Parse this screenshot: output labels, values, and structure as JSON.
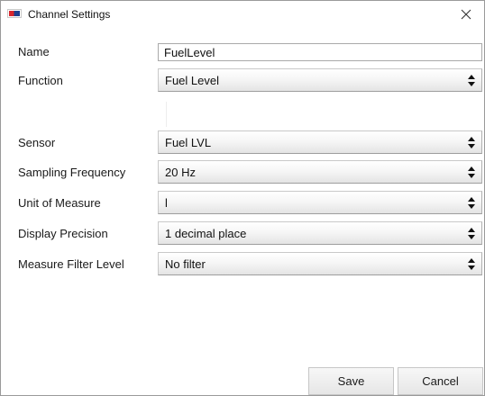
{
  "window": {
    "title": "Channel Settings",
    "icon": "app-logo-icon",
    "close_icon": "close-icon"
  },
  "form": {
    "name": {
      "label": "Name",
      "value": "FuelLevel"
    },
    "function": {
      "label": "Function",
      "value": "Fuel Level"
    },
    "sensor": {
      "label": "Sensor",
      "value": "Fuel LVL"
    },
    "sampling_frequency": {
      "label": "Sampling Frequency",
      "value": "20 Hz"
    },
    "unit_of_measure": {
      "label": "Unit of Measure",
      "value": "l"
    },
    "display_precision": {
      "label": "Display Precision",
      "value": "1 decimal place"
    },
    "measure_filter_level": {
      "label": "Measure Filter Level",
      "value": "No filter"
    }
  },
  "footer": {
    "save_label": "Save",
    "cancel_label": "Cancel"
  },
  "colors": {
    "window_border": "#9a9a9a",
    "background": "#ffffff",
    "control_border": "#c9c9c9",
    "text": "#1a1a1a"
  }
}
